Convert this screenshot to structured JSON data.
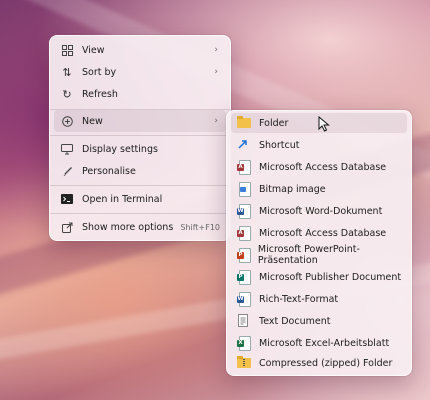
{
  "context_menu": {
    "items": [
      {
        "label": "View",
        "icon": "grid-icon"
      },
      {
        "label": "Sort by",
        "icon": "sort-icon"
      },
      {
        "label": "Refresh",
        "icon": "refresh-icon"
      },
      {
        "label": "New",
        "icon": "plus-circle-icon"
      },
      {
        "label": "Display settings",
        "icon": "display-icon"
      },
      {
        "label": "Personalise",
        "icon": "brush-icon"
      },
      {
        "label": "Open in Terminal",
        "icon": "terminal-icon"
      },
      {
        "label": "Show more options",
        "icon": "share-icon",
        "shortcut": "Shift+F10"
      }
    ]
  },
  "new_submenu": {
    "items": [
      {
        "label": "Folder",
        "icon": "folder-icon"
      },
      {
        "label": "Shortcut",
        "icon": "shortcut-arrow-icon"
      },
      {
        "label": "Microsoft Access Database",
        "icon": "access-icon"
      },
      {
        "label": "Bitmap image",
        "icon": "bitmap-icon"
      },
      {
        "label": "Microsoft Word-Dokument",
        "icon": "word-icon"
      },
      {
        "label": "Microsoft Access Database",
        "icon": "access-icon"
      },
      {
        "label": "Microsoft PowerPoint-Präsentation",
        "icon": "powerpoint-icon"
      },
      {
        "label": "Microsoft Publisher Document",
        "icon": "publisher-icon"
      },
      {
        "label": "Rich-Text-Format",
        "icon": "richtext-icon"
      },
      {
        "label": "Text Document",
        "icon": "text-document-icon"
      },
      {
        "label": "Microsoft Excel-Arbeitsblatt",
        "icon": "excel-icon"
      },
      {
        "label": "Compressed (zipped) Folder",
        "icon": "zip-folder-icon"
      }
    ]
  },
  "colors": {
    "word": "#2b5797",
    "access": "#a4373a",
    "powerpoint": "#c43e1c",
    "publisher": "#077568",
    "excel": "#1e7145",
    "folder": "#f3c14a"
  }
}
